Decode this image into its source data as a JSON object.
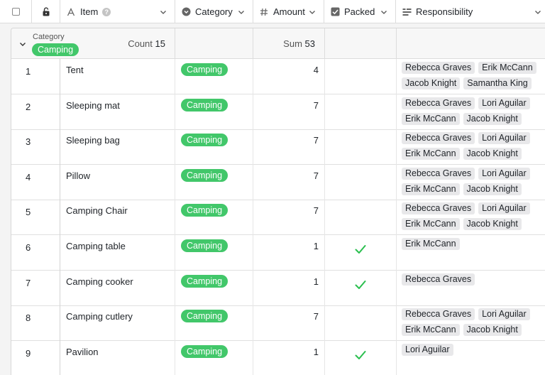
{
  "header": {
    "columns": [
      {
        "key": "item",
        "label": "Item"
      },
      {
        "key": "category",
        "label": "Category"
      },
      {
        "key": "amount",
        "label": "Amount"
      },
      {
        "key": "packed",
        "label": "Packed"
      },
      {
        "key": "responsibility",
        "label": "Responsibility"
      }
    ]
  },
  "group": {
    "field_label": "Category",
    "value": "Camping",
    "count_label": "Count",
    "count": "15",
    "sum_label": "Sum",
    "sum": "53"
  },
  "colors": {
    "pill": "#42c76a",
    "check": "#2bbf4f",
    "tag_bg": "#e8e8ea"
  },
  "rows": [
    {
      "num": "1",
      "item": "Tent",
      "category": "Camping",
      "amount": "4",
      "packed": false,
      "responsibility": [
        "Rebecca Graves",
        "Erik McCann",
        "Jacob Knight",
        "Samantha King"
      ]
    },
    {
      "num": "2",
      "item": "Sleeping mat",
      "category": "Camping",
      "amount": "7",
      "packed": false,
      "responsibility": [
        "Rebecca Graves",
        "Lori Aguilar",
        "Erik McCann",
        "Jacob Knight"
      ]
    },
    {
      "num": "3",
      "item": "Sleeping bag",
      "category": "Camping",
      "amount": "7",
      "packed": false,
      "responsibility": [
        "Rebecca Graves",
        "Lori Aguilar",
        "Erik McCann",
        "Jacob Knight"
      ]
    },
    {
      "num": "4",
      "item": "Pillow",
      "category": "Camping",
      "amount": "7",
      "packed": false,
      "responsibility": [
        "Rebecca Graves",
        "Lori Aguilar",
        "Erik McCann",
        "Jacob Knight"
      ]
    },
    {
      "num": "5",
      "item": "Camping Chair",
      "category": "Camping",
      "amount": "7",
      "packed": false,
      "responsibility": [
        "Rebecca Graves",
        "Lori Aguilar",
        "Erik McCann",
        "Jacob Knight"
      ]
    },
    {
      "num": "6",
      "item": "Camping table",
      "category": "Camping",
      "amount": "1",
      "packed": true,
      "responsibility": [
        "Erik McCann"
      ]
    },
    {
      "num": "7",
      "item": "Camping cooker",
      "category": "Camping",
      "amount": "1",
      "packed": true,
      "responsibility": [
        "Rebecca Graves"
      ]
    },
    {
      "num": "8",
      "item": "Camping cutlery",
      "category": "Camping",
      "amount": "7",
      "packed": false,
      "responsibility": [
        "Rebecca Graves",
        "Lori Aguilar",
        "Erik McCann",
        "Jacob Knight"
      ]
    },
    {
      "num": "9",
      "item": "Pavilion",
      "category": "Camping",
      "amount": "1",
      "packed": true,
      "responsibility": [
        "Lori Aguilar"
      ]
    }
  ]
}
